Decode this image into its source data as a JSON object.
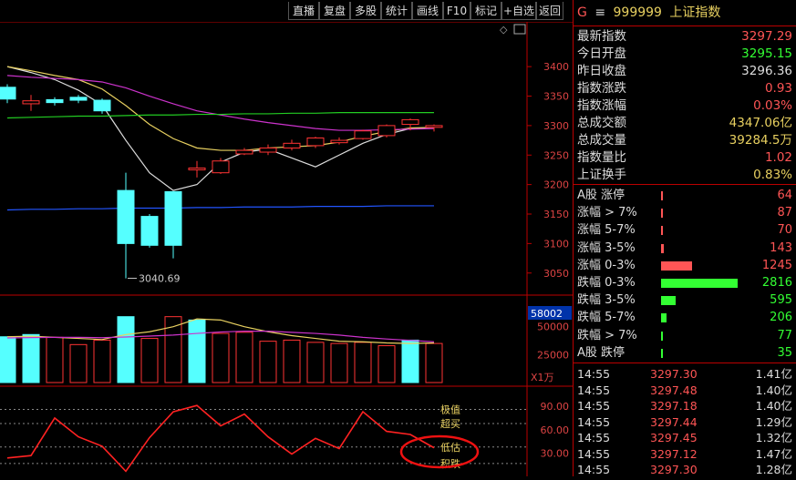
{
  "toolbar": {
    "buttons": [
      "直播",
      "复盘",
      "多股",
      "统计",
      "画线",
      "F10",
      "标记",
      "+自选",
      "返回"
    ]
  },
  "chart_data": [
    {
      "type": "candlestick",
      "title": "",
      "yticks": [
        3400,
        3350,
        3300,
        3250,
        3200,
        3150,
        3100,
        3050
      ],
      "ylim": [
        3028,
        3445
      ],
      "low_label": "3040.69",
      "candles": [
        {
          "o": 3365,
          "c": 3345,
          "h": 3370,
          "l": 3338
        },
        {
          "o": 3337,
          "c": 3342,
          "h": 3352,
          "l": 3325
        },
        {
          "o": 3344,
          "c": 3339,
          "h": 3348,
          "l": 3334
        },
        {
          "o": 3348,
          "c": 3343,
          "h": 3352,
          "l": 3338
        },
        {
          "o": 3343,
          "c": 3325,
          "h": 3346,
          "l": 3320
        },
        {
          "o": 3190,
          "c": 3100,
          "h": 3220,
          "l": 3041
        },
        {
          "o": 3146,
          "c": 3097,
          "h": 3150,
          "l": 3093
        },
        {
          "o": 3188,
          "c": 3097,
          "h": 3188,
          "l": 3075
        },
        {
          "o": 3225,
          "c": 3228,
          "h": 3240,
          "l": 3212
        },
        {
          "o": 3220,
          "c": 3240,
          "h": 3245,
          "l": 3218
        },
        {
          "o": 3252,
          "c": 3258,
          "h": 3262,
          "l": 3250
        },
        {
          "o": 3255,
          "c": 3262,
          "h": 3268,
          "l": 3250
        },
        {
          "o": 3262,
          "c": 3270,
          "h": 3276,
          "l": 3258
        },
        {
          "o": 3266,
          "c": 3279,
          "h": 3281,
          "l": 3262
        },
        {
          "o": 3271,
          "c": 3275,
          "h": 3280,
          "l": 3268
        },
        {
          "o": 3278,
          "c": 3291,
          "h": 3293,
          "l": 3276
        },
        {
          "o": 3283,
          "c": 3300,
          "h": 3302,
          "l": 3280
        },
        {
          "o": 3302,
          "c": 3310,
          "h": 3312,
          "l": 3292
        },
        {
          "o": 3297,
          "c": 3300,
          "h": 3302,
          "l": 3290
        }
      ],
      "ma_lines": [
        {
          "color": "#dddddd",
          "values": [
            3400,
            3390,
            3378,
            3360,
            3335,
            3275,
            3220,
            3190,
            3200,
            3238,
            3255,
            3260,
            3245,
            3230,
            3250,
            3270,
            3285,
            3295,
            3297
          ]
        },
        {
          "color": "#e8d060",
          "values": [
            3400,
            3393,
            3385,
            3378,
            3362,
            3334,
            3302,
            3278,
            3262,
            3258,
            3258,
            3262,
            3264,
            3266,
            3272,
            3282,
            3290,
            3296,
            3297
          ]
        },
        {
          "color": "#cc33cc",
          "values": [
            3385,
            3382,
            3380,
            3378,
            3374,
            3364,
            3350,
            3337,
            3325,
            3318,
            3311,
            3305,
            3300,
            3295,
            3292,
            3292,
            3293,
            3294,
            3295
          ]
        },
        {
          "color": "#22cc22",
          "values": [
            3313,
            3314,
            3315,
            3316,
            3316,
            3317,
            3318,
            3318,
            3319,
            3319,
            3320,
            3320,
            3321,
            3321,
            3322,
            3322,
            3322,
            3322,
            3322
          ]
        },
        {
          "color": "#2255ff",
          "values": [
            3157,
            3158,
            3158,
            3159,
            3159,
            3160,
            3160,
            3160,
            3161,
            3161,
            3162,
            3162,
            3162,
            3163,
            3163,
            3163,
            3164,
            3164,
            3164
          ]
        }
      ]
    },
    {
      "type": "bar",
      "title": "",
      "top_label": "58002",
      "yticks": [
        50000,
        25000
      ],
      "unit": "X1万",
      "ylim": [
        0,
        62000
      ],
      "values": [
        41000,
        43000,
        40500,
        34000,
        38000,
        59000,
        39500,
        59000,
        56000,
        44000,
        45000,
        37000,
        38000,
        36000,
        35000,
        36000,
        33000,
        38000,
        35000
      ],
      "highlight": [
        true,
        true,
        false,
        false,
        false,
        true,
        false,
        false,
        true,
        false,
        false,
        false,
        false,
        false,
        false,
        false,
        false,
        true,
        false
      ],
      "ma_lines": [
        {
          "color": "#e8d060",
          "values": [
            41000,
            41500,
            40500,
            39500,
            38500,
            43000,
            45500,
            50000,
            57000,
            56000,
            50000,
            45500,
            42000,
            39500,
            37000,
            36500,
            35500,
            35000,
            35500
          ]
        },
        {
          "color": "#cc33cc",
          "values": [
            40000,
            40300,
            40500,
            40500,
            40200,
            40800,
            41600,
            42500,
            44000,
            45300,
            46000,
            46000,
            45000,
            44000,
            42500,
            40500,
            39000,
            37800,
            36500
          ]
        }
      ]
    },
    {
      "type": "line",
      "title": "",
      "yticks": [
        90.0,
        60.0,
        30.0
      ],
      "ylim": [
        4,
        104
      ],
      "ref_lines": [
        {
          "value": 86,
          "label": "极值",
          "color": "#e8d060"
        },
        {
          "value": 68,
          "label": "超买",
          "color": "#e8d060"
        },
        {
          "value": 38,
          "label": "低估",
          "color": "#e8d060"
        },
        {
          "value": 17,
          "label": "积跌",
          "color": "#e8d060"
        }
      ],
      "values": [
        24,
        27,
        75,
        51,
        39,
        7,
        50,
        83,
        91,
        65,
        80,
        51,
        29,
        49,
        36,
        83,
        58,
        54,
        37
      ]
    }
  ],
  "header": {
    "market": "G",
    "menu_icon": "≡",
    "code": "999999",
    "name": "上证指数"
  },
  "quotes": [
    {
      "label": "最新指数",
      "value": "3297.29",
      "color": "#ff5555"
    },
    {
      "label": "今日开盘",
      "value": "3295.15",
      "color": "#33ff33"
    },
    {
      "label": "昨日收盘",
      "value": "3296.36",
      "color": "#dddddd"
    },
    {
      "label": "指数涨跌",
      "value": "0.93",
      "color": "#ff5555"
    },
    {
      "label": "指数涨幅",
      "value": "0.03%",
      "color": "#ff5555"
    },
    {
      "label": "总成交额",
      "value": "4347.06亿",
      "color": "#e8d060"
    },
    {
      "label": "总成交量",
      "value": "39284.5万",
      "color": "#e8d060"
    },
    {
      "label": "指数量比",
      "value": "1.02",
      "color": "#ff5555"
    },
    {
      "label": "上证换手",
      "value": "0.83%",
      "color": "#e8d060"
    }
  ],
  "breadth": [
    {
      "label": "A股 涨停",
      "value": "64",
      "color": "#ff5555",
      "fraction": 0.01
    },
    {
      "label": "涨幅 > 7%",
      "value": "87",
      "color": "#ff5555",
      "fraction": 0.012
    },
    {
      "label": "涨幅 5-7%",
      "value": "70",
      "color": "#ff5555",
      "fraction": 0.01
    },
    {
      "label": "涨幅 3-5%",
      "value": "143",
      "color": "#ff5555",
      "fraction": 0.03
    },
    {
      "label": "涨幅 0-3%",
      "value": "1245",
      "color": "#ff5555",
      "fraction": 0.39
    },
    {
      "label": "跌幅 0-3%",
      "value": "2816",
      "color": "#33ff33",
      "fraction": 0.98
    },
    {
      "label": "跌幅 3-5%",
      "value": "595",
      "color": "#33ff33",
      "fraction": 0.19
    },
    {
      "label": "跌幅 5-7%",
      "value": "206",
      "color": "#33ff33",
      "fraction": 0.07
    },
    {
      "label": "跌幅 > 7%",
      "value": "77",
      "color": "#33ff33",
      "fraction": 0.02
    },
    {
      "label": "A股 跌停",
      "value": "35",
      "color": "#33ff33",
      "fraction": 0.01
    }
  ],
  "ticks": [
    {
      "time": "14:55",
      "price": "3297.30",
      "vol": "1.41亿"
    },
    {
      "time": "14:55",
      "price": "3297.48",
      "vol": "1.40亿"
    },
    {
      "time": "14:55",
      "price": "3297.18",
      "vol": "1.40亿"
    },
    {
      "time": "14:55",
      "price": "3297.44",
      "vol": "1.29亿"
    },
    {
      "time": "14:55",
      "price": "3297.45",
      "vol": "1.32亿"
    },
    {
      "time": "14:55",
      "price": "3297.12",
      "vol": "1.47亿"
    },
    {
      "time": "14:55",
      "price": "3297.30",
      "vol": "1.28亿"
    }
  ]
}
